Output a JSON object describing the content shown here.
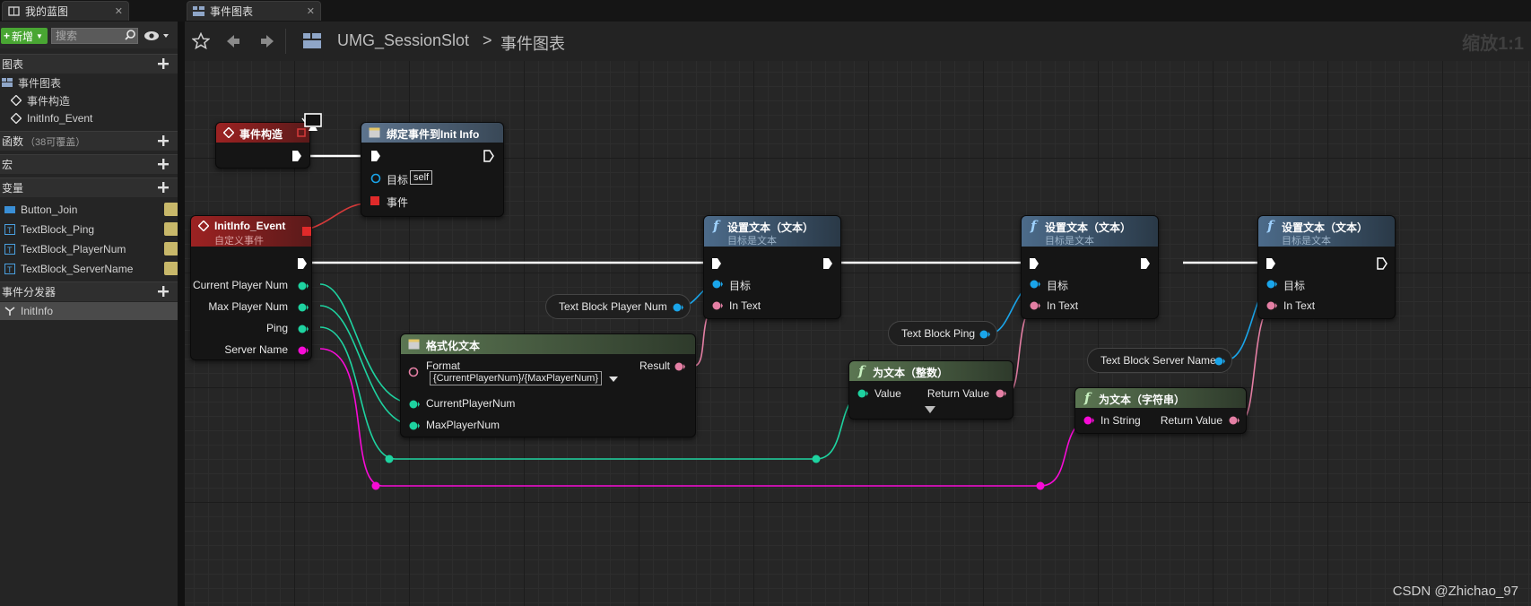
{
  "tabs": [
    {
      "label": "我的蓝图"
    },
    {
      "label": "事件图表"
    }
  ],
  "left_panel": {
    "add_label": "新增",
    "search_placeholder": "搜索",
    "sections": {
      "graphs": "图表",
      "functions": "函数",
      "functions_sub": "（38可覆盖）",
      "macros": "宏",
      "variables": "变量",
      "dispatchers": "事件分发器"
    },
    "graph_items": [
      "事件图表",
      "事件构造",
      "InitInfo_Event"
    ],
    "variables": [
      "Button_Join",
      "TextBlock_Ping",
      "TextBlock_PlayerNum",
      "TextBlock_ServerName"
    ],
    "dispatchers": [
      "InitInfo"
    ]
  },
  "toolbar": {
    "breadcrumb_root": "UMG_SessionSlot",
    "breadcrumb_sep": ">",
    "breadcrumb_current": "事件图表",
    "zoom_text": "缩放1:1"
  },
  "nodes": {
    "construct": {
      "title": "事件构造"
    },
    "bind": {
      "title": "绑定事件到Init Info",
      "target_label": "目标",
      "target_value": "self",
      "event_label": "事件"
    },
    "init_event": {
      "title": "InitInfo_Event",
      "subtitle": "自定义事件",
      "pins": [
        "Current Player Num",
        "Max Player Num",
        "Ping",
        "Server Name"
      ]
    },
    "format_text": {
      "title": "格式化文本",
      "format_label": "Format",
      "format_value": "{CurrentPlayerNum}/{MaxPlayerNum}",
      "result_label": "Result",
      "inputs": [
        "CurrentPlayerNum",
        "MaxPlayerNum"
      ]
    },
    "set_text_1": {
      "title": "设置文本（文本）",
      "subtitle": "目标是文本",
      "target": "目标",
      "in_text": "In Text"
    },
    "set_text_2": {
      "title": "设置文本（文本）",
      "subtitle": "目标是文本",
      "target": "目标",
      "in_text": "In Text"
    },
    "set_text_3": {
      "title": "设置文本（文本）",
      "subtitle": "目标是文本",
      "target": "目标",
      "in_text": "In Text"
    },
    "to_text_int": {
      "title": "为文本（整数）",
      "in_label": "Value",
      "out_label": "Return Value"
    },
    "to_text_str": {
      "title": "为文本（字符串）",
      "in_label": "In String",
      "out_label": "Return Value"
    },
    "getters": [
      "Text Block Player Num",
      "Text Block Ping",
      "Text Block Server Name"
    ]
  },
  "watermark": "CSDN @Zhichao_97",
  "colors": {
    "exec": "#ffffff",
    "int_pin": "#1ed3a0",
    "string_pin": "#f70bd6",
    "text_pin": "#e47fa4",
    "object_pin": "#1aa5ea",
    "event_head": "#8a1c1c",
    "function_head": "#3a5a78",
    "pure_head": "#445c3c"
  }
}
